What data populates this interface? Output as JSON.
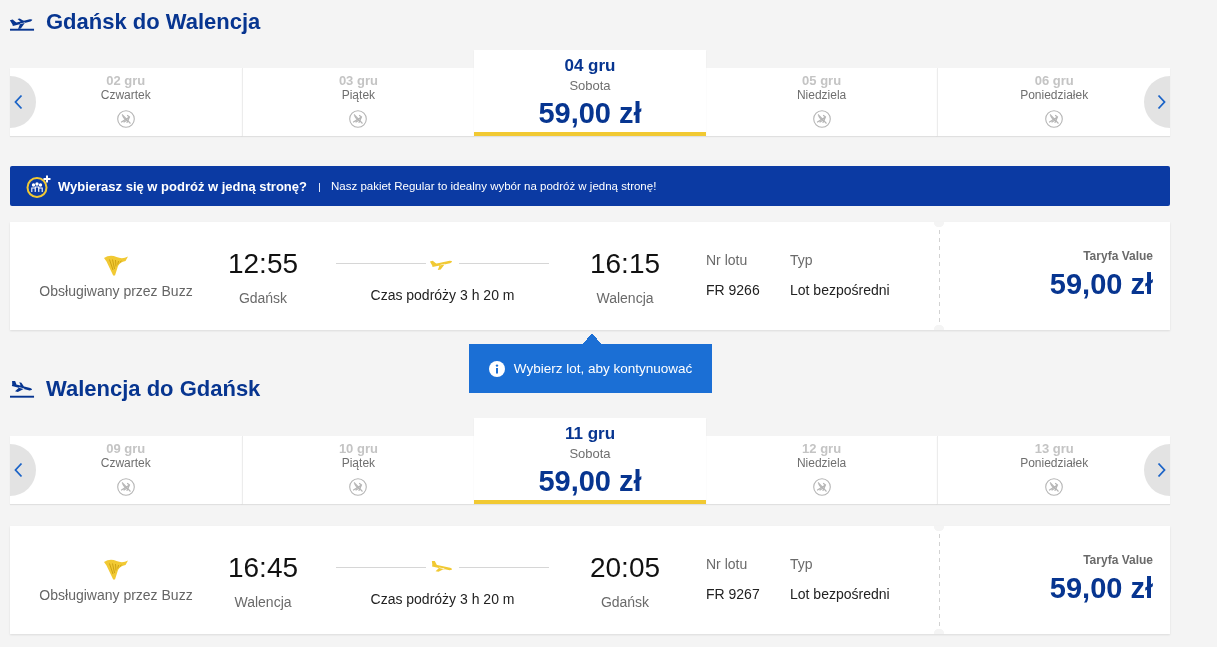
{
  "journeys": [
    {
      "kind": "outbound",
      "title": "Gdańsk do Walencja",
      "dates": [
        {
          "date": "02 gru",
          "day": "Czwartek",
          "selected": false
        },
        {
          "date": "03 gru",
          "day": "Piątek",
          "selected": false
        },
        {
          "date": "04 gru",
          "day": "Sobota",
          "price": "59,00 zł",
          "selected": true
        },
        {
          "date": "05 gru",
          "day": "Niedziela",
          "selected": false
        },
        {
          "date": "06 gru",
          "day": "Poniedziałek",
          "selected": false
        }
      ],
      "banner": {
        "title": "Wybierasz się w podróż w jedną stronę?",
        "text": "Nasz pakiet Regular to idealny wybór na podróż w jedną stronę!"
      },
      "flight": {
        "operator": "Obsługiwany przez Buzz",
        "departure_time": "12:55",
        "departure_city": "Gdańsk",
        "duration": "Czas podróży 3 h 20 m",
        "arrival_time": "16:15",
        "arrival_city": "Walencja",
        "number_label": "Nr lotu",
        "number": "FR 9266",
        "type_label": "Typ",
        "type": "Lot bezpośredni",
        "fare_label": "Taryfa Value",
        "price": "59,00 zł"
      },
      "tooltip": "Wybierz lot, aby kontynuować"
    },
    {
      "kind": "inbound",
      "title": "Walencja do Gdańsk",
      "dates": [
        {
          "date": "09 gru",
          "day": "Czwartek",
          "selected": false
        },
        {
          "date": "10 gru",
          "day": "Piątek",
          "selected": false
        },
        {
          "date": "11 gru",
          "day": "Sobota",
          "price": "59,00 zł",
          "selected": true
        },
        {
          "date": "12 gru",
          "day": "Niedziela",
          "selected": false
        },
        {
          "date": "13 gru",
          "day": "Poniedziałek",
          "selected": false
        }
      ],
      "flight": {
        "operator": "Obsługiwany przez Buzz",
        "departure_time": "16:45",
        "departure_city": "Walencja",
        "duration": "Czas podróży 3 h 20 m",
        "arrival_time": "20:05",
        "arrival_city": "Gdańsk",
        "number_label": "Nr lotu",
        "number": "FR 9267",
        "type_label": "Typ",
        "type": "Lot bezpośredni",
        "fare_label": "Taryfa Value",
        "price": "59,00 zł"
      }
    }
  ]
}
